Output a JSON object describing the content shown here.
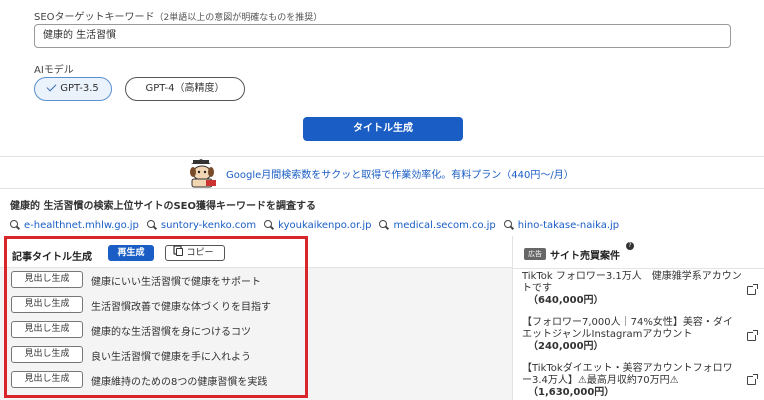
{
  "seo": {
    "label": "SEOターゲットキーワード",
    "hint": "（2単語以上の意図が明確なものを推奨）",
    "value": "健康的 生活習慣"
  },
  "ai_model": {
    "label": "AIモデル",
    "options": [
      {
        "label": "GPT-3.5",
        "selected": true
      },
      {
        "label": "GPT-4（高精度）",
        "selected": false
      }
    ]
  },
  "generate_button": "タイトル生成",
  "promo": {
    "icon": "dog-mascot-icon",
    "text": "Google月間検索数をサクッと取得で作業効率化。有料プラン（440円〜/月）"
  },
  "research": {
    "title": "健康的 生活習慣の検索上位サイトのSEO獲得キーワードを調査する",
    "sites": [
      "e-healthnet.mhlw.go.jp",
      "suntory-kenko.com",
      "kyoukaikenpo.or.jp",
      "medical.secom.co.jp",
      "hino-takase-naika.jp"
    ]
  },
  "article_titles": {
    "heading": "記事タイトル生成",
    "regenerate": "再生成",
    "copy": "コピー",
    "heading_button": "見出し生成",
    "titles": [
      "健康にいい生活習慣で健康をサポート",
      "生活習慣改善で健康な体づくりを目指す",
      "健康的な生活習慣を身につけるコツ",
      "良い生活習慣で健康を手に入れよう",
      "健康維持のための8つの健康習慣を実践"
    ]
  },
  "sidebar": {
    "badge": "広告",
    "title": "サイト売買案件",
    "deals": [
      {
        "text": "TikTok フォロワー3.1万人　健康雑学系アカウントです",
        "price": "（640,000円）"
      },
      {
        "text": "【フォロワー7,000人｜74%女性】美容・ダイエットジャンルInstagramアカウント",
        "price": "（240,000円）"
      },
      {
        "text": "【TikTokダイエット・美容アカウントフォロワー3.4万人】⚠最高月収約70万円⚠",
        "price": "（1,630,000円）"
      }
    ]
  },
  "colors": {
    "primary": "#1a5dc4",
    "highlight": "#d9262c"
  }
}
